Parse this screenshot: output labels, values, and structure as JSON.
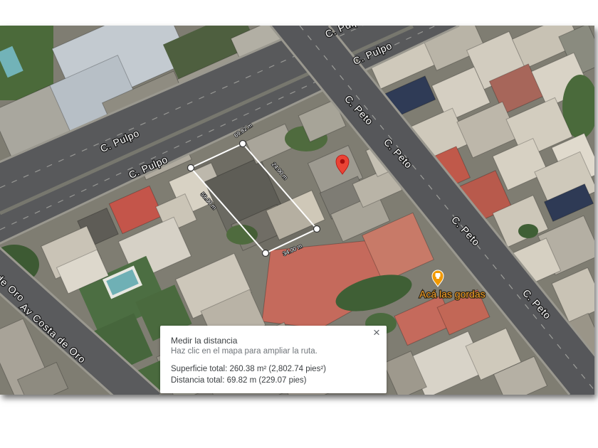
{
  "map": {
    "street_labels": [
      "C. Pulpo",
      "C. Pulpo",
      "C. Pulpo",
      "C. Pulpo",
      "C. Peto",
      "C. Peto",
      "C. Peto",
      "C. Peto",
      "Av Costa de Oro",
      "Av Costa de Oro"
    ]
  },
  "measure": {
    "vertex_labels": [
      "69.82 m",
      "24.00 m",
      "34.00 m",
      "59.00 m"
    ]
  },
  "poi": {
    "label": "Acá las gordas",
    "icon": "restaurant-pin-icon"
  },
  "pin": {
    "icon": "red-location-pin-icon"
  },
  "measure_panel": {
    "title": "Medir la distancia",
    "hint": "Haz clic en el mapa para ampliar la ruta.",
    "close_label": "×",
    "close_icon": "close-icon",
    "total_area": "Superficie total: 260.38 m² (2,802.74 pies²)",
    "total_distance": "Distancia total: 69.82 m (229.07 pies)"
  },
  "colors": {
    "pin": "#ea4335",
    "pin_dot": "#a50e0e",
    "poi": "#f29900",
    "poi_label": "#f6a024",
    "measure_line": "#ffffff"
  }
}
